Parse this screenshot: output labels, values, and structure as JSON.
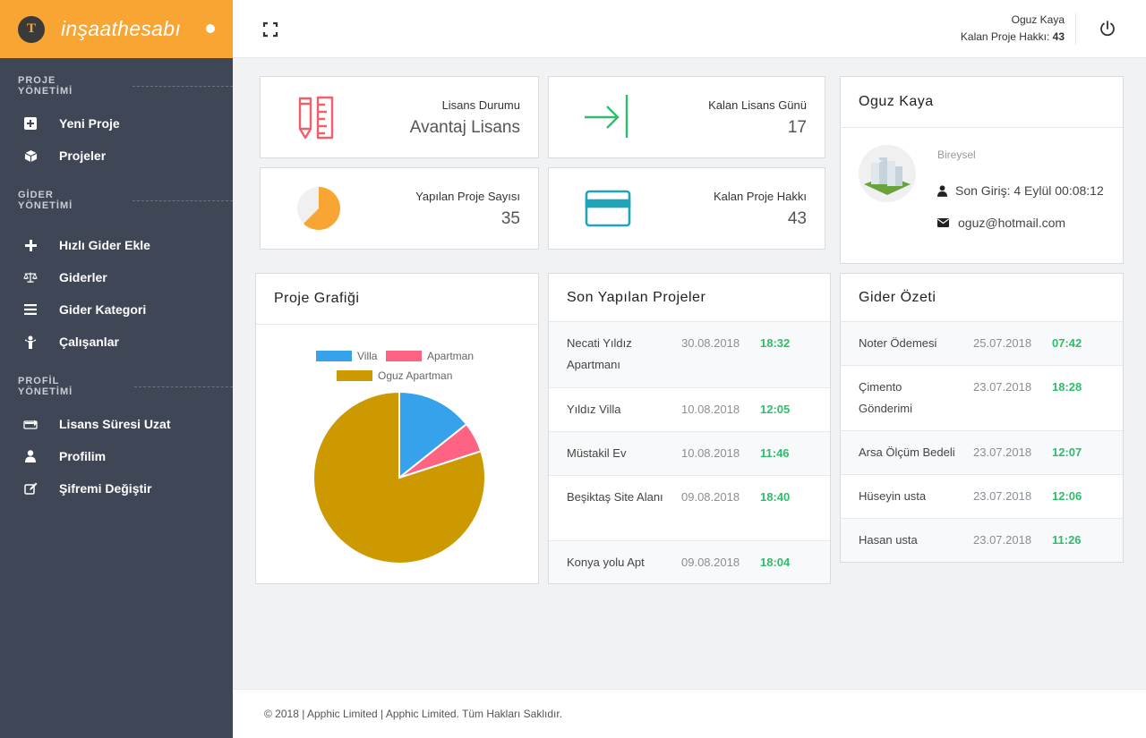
{
  "brand": {
    "logo_letter": "T",
    "name": "inşaathesabı"
  },
  "sidebar": {
    "sections": [
      {
        "title": "PROJE YÖNETİMİ"
      },
      {
        "title": "GİDER YÖNETİMİ"
      },
      {
        "title": "PROFİL YÖNETİMİ"
      }
    ],
    "items": [
      {
        "label": "Yeni Proje",
        "icon": "plus-square-icon"
      },
      {
        "label": "Projeler",
        "icon": "cube-icon"
      },
      {
        "label": "Hızlı Gider Ekle",
        "icon": "plus-icon"
      },
      {
        "label": "Giderler",
        "icon": "balance-scale-icon"
      },
      {
        "label": "Gider Kategori",
        "icon": "list-icon"
      },
      {
        "label": "Çalışanlar",
        "icon": "worker-icon"
      },
      {
        "label": "Lisans Süresi Uzat",
        "icon": "exchange-icon"
      },
      {
        "label": "Profilim",
        "icon": "user-icon"
      },
      {
        "label": "Şifremi Değiştir",
        "icon": "edit-icon"
      }
    ]
  },
  "header": {
    "user_name": "Oguz Kaya",
    "remaining_label": "Kalan Proje Hakkı:",
    "remaining_value": "43"
  },
  "stats": [
    {
      "label": "Lisans Durumu",
      "value": "Avantaj Lisans",
      "icon": "pencil-ruler-icon",
      "color": "#f0606b"
    },
    {
      "label": "Kalan Lisans Günü",
      "value": "17",
      "icon": "sign-in-icon",
      "color": "#2ebd6b"
    },
    {
      "label": "Yapılan Proje Sayısı",
      "value": "35",
      "icon": "pie-chart-icon",
      "color": "#f8a534"
    },
    {
      "label": "Kalan Proje Hakkı",
      "value": "43",
      "icon": "credit-card-icon",
      "color": "#1fa5b8"
    }
  ],
  "profile": {
    "name": "Oguz Kaya",
    "type": "Bireysel",
    "last_login": "Son Giriş: 4 Eylül 00:08:12",
    "email": "oguz@hotmail.com"
  },
  "chart_panel": {
    "title": "Proje Grafiği"
  },
  "chart_data": {
    "type": "pie",
    "labels": [
      "Villa",
      "Apartman",
      "Oguz Apartman"
    ],
    "values": [
      5,
      2,
      28
    ],
    "colors": [
      "#36a2eb",
      "#ff6384",
      "#cc9a00"
    ]
  },
  "recent_projects": {
    "title": "Son Yapılan Projeler",
    "rows": [
      {
        "name": "Necati Yıldız Apartmanı",
        "date": "30.08.2018",
        "time": "18:32"
      },
      {
        "name": "Yıldız Villa",
        "date": "10.08.2018",
        "time": "12:05"
      },
      {
        "name": "Müstakil Ev",
        "date": "10.08.2018",
        "time": "11:46"
      },
      {
        "name": "Beşiktaş Site Alanı",
        "date": "09.08.2018",
        "time": "18:40"
      },
      {
        "name": "Konya yolu Apt",
        "date": "09.08.2018",
        "time": "18:04"
      }
    ]
  },
  "expenses": {
    "title": "Gider Özeti",
    "rows": [
      {
        "name": "Noter Ödemesi",
        "date": "25.07.2018",
        "time": "07:42"
      },
      {
        "name": "Çimento Gönderimi",
        "date": "23.07.2018",
        "time": "18:28"
      },
      {
        "name": "Arsa Ölçüm Bedeli",
        "date": "23.07.2018",
        "time": "12:07"
      },
      {
        "name": "Hüseyin usta",
        "date": "23.07.2018",
        "time": "12:06"
      },
      {
        "name": "Hasan usta",
        "date": "23.07.2018",
        "time": "11:26"
      }
    ]
  },
  "footer": {
    "text": "© 2018 | Apphic Limited | Apphic Limited. Tüm Hakları Saklıdır."
  }
}
